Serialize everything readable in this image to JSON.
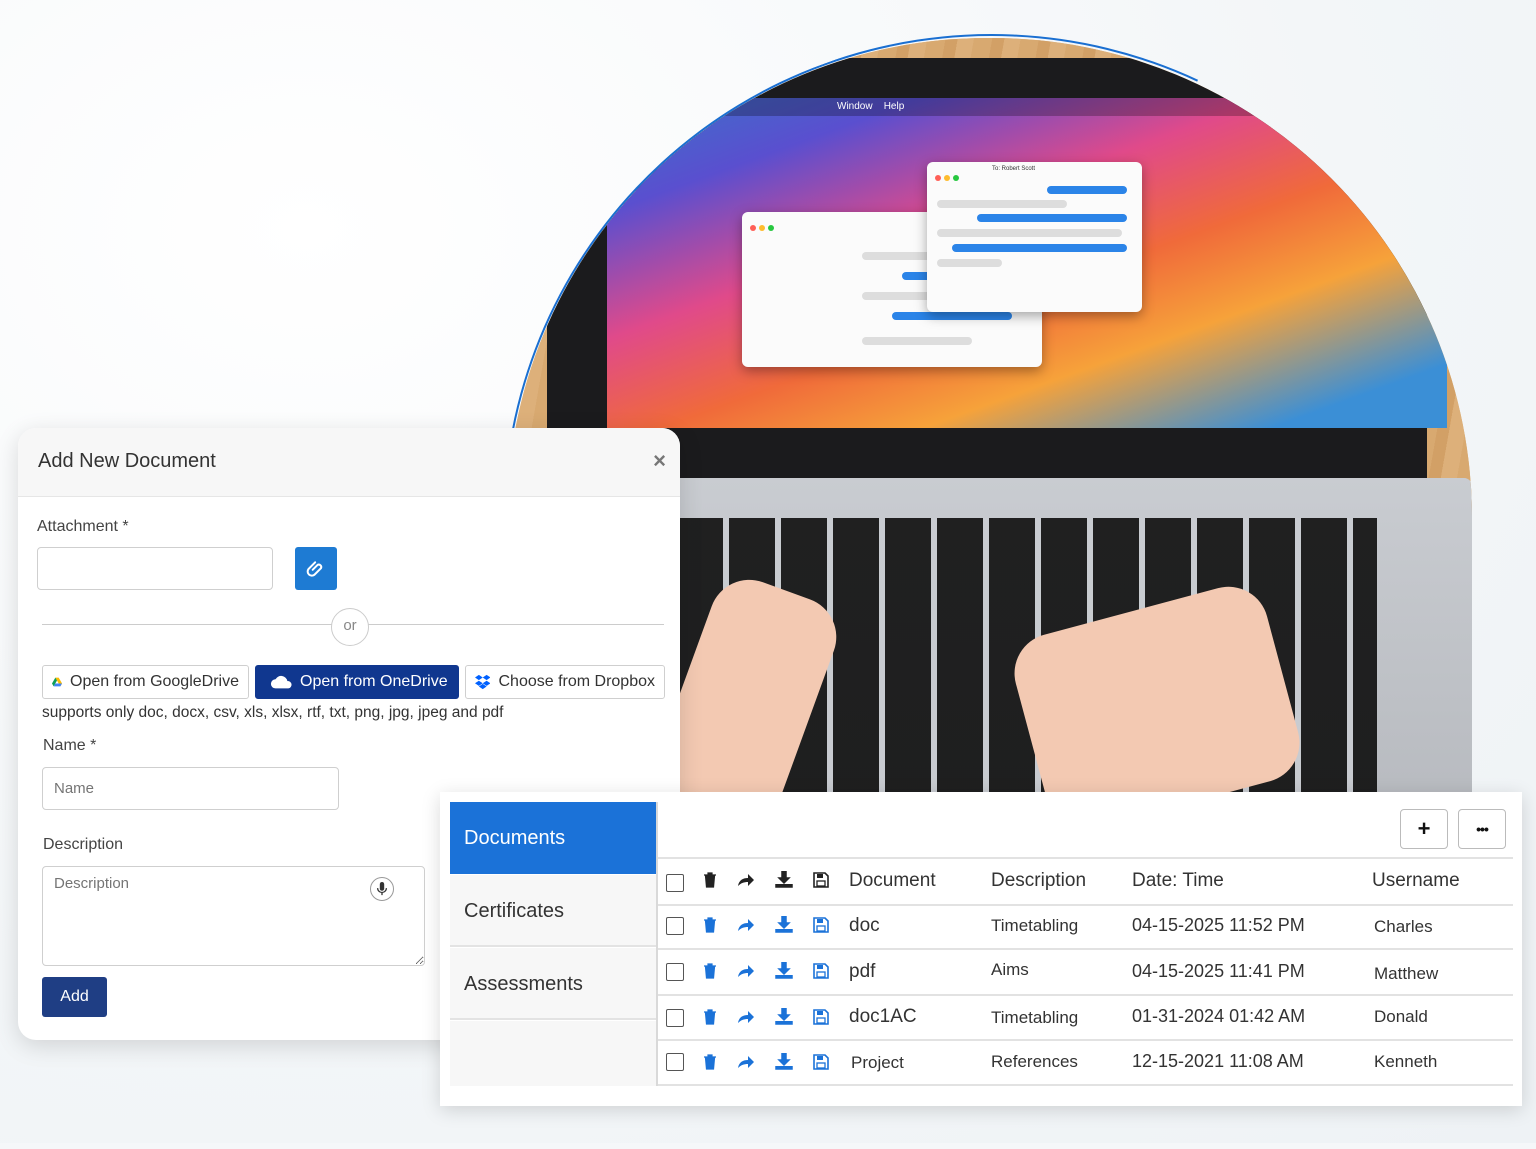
{
  "dialog": {
    "title": "Add New Document",
    "close_glyph": "×",
    "attachment_label": "Attachment *",
    "attachment_value": "",
    "or_text": "or",
    "google_drive_label": "Open from GoogleDrive",
    "onedrive_label": "Open from OneDrive",
    "dropbox_label": "Choose from Dropbox",
    "supported_note": "supports only doc, docx, csv, xls, xlsx, rtf, txt, png, jpg, jpeg and pdf",
    "name_label": "Name *",
    "name_placeholder": "Name",
    "description_label": "Description",
    "description_placeholder": "Description",
    "add_label": "Add",
    "colors": {
      "attach_button": "#1e7bd3",
      "onedrive_button": "#10378f",
      "add_button": "#1f3e84"
    }
  },
  "panel": {
    "tabs": [
      {
        "label": "Documents",
        "active": true
      },
      {
        "label": "Certificates",
        "active": false
      },
      {
        "label": "Assessments",
        "active": false
      }
    ],
    "toolbar": {
      "add_glyph": "+",
      "more_glyph": "•••"
    },
    "columns": [
      "Document",
      "Description",
      "Date: Time",
      "Username"
    ],
    "rows": [
      {
        "document": "doc",
        "description": "Timetabling",
        "datetime": "04-15-2025 11:52 PM",
        "username": "Charles"
      },
      {
        "document": "pdf",
        "description": "Aims",
        "datetime": "04-15-2025 11:41 PM",
        "username": "Matthew"
      },
      {
        "document": "doc1AC",
        "description": "Timetabling",
        "datetime": "01-31-2024 01:42 AM",
        "username": "Donald"
      },
      {
        "document": "Project",
        "description": "References",
        "datetime": "12-15-2021 11:08 AM",
        "username": "Kenneth"
      }
    ],
    "row_icons": [
      "checkbox",
      "trash-icon",
      "share-icon",
      "download-icon",
      "save-icon"
    ],
    "colors": {
      "active_tab": "#1b72d8",
      "row_icon": "#1b72d8"
    }
  },
  "hero": {
    "menubar_items": [
      "Window",
      "Help"
    ],
    "chat_recipient": "To: Robert Scott"
  }
}
